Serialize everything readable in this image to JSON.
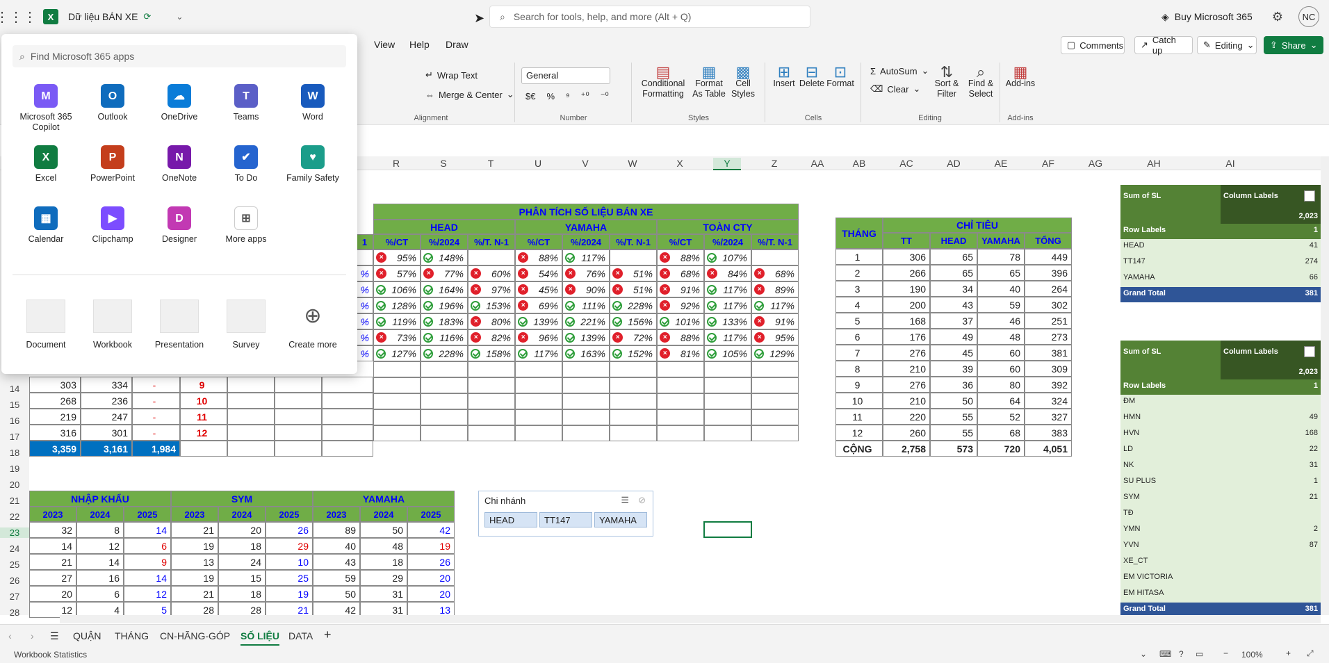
{
  "titlebar": {
    "doc_title": "Dữ liệu BÁN XE",
    "search_placeholder": "Search for tools, help, and more (Alt + Q)",
    "buy_label": "Buy Microsoft 365",
    "avatar_initials": "NC"
  },
  "menu": {
    "tabs": [
      "View",
      "Help",
      "Draw"
    ],
    "comments": "Comments",
    "catchup": "Catch up",
    "editing": "Editing",
    "share": "Share"
  },
  "ribbon": {
    "wrap_text": "Wrap Text",
    "merge_center": "Merge & Center",
    "number_format": "General",
    "conditional_formatting": "Conditional Formatting",
    "format_as_table": "Format As Table",
    "cell_styles": "Cell Styles",
    "insert": "Insert",
    "delete": "Delete",
    "format": "Format",
    "autosum": "AutoSum",
    "clear": "Clear",
    "sort_filter": "Sort & Filter",
    "find_select": "Find & Select",
    "addins": "Add-ins",
    "groups": {
      "alignment": "Alignment",
      "number": "Number",
      "styles": "Styles",
      "cells": "Cells",
      "editing": "Editing",
      "addins": "Add-ins"
    }
  },
  "columns": [
    "R",
    "S",
    "T",
    "U",
    "V",
    "W",
    "X",
    "Y",
    "Z",
    "AA",
    "AB",
    "AC",
    "AD",
    "AE",
    "AF",
    "AG",
    "AH",
    "AI"
  ],
  "rows": [
    "14",
    "15",
    "16",
    "17",
    "18",
    "19",
    "20",
    "21",
    "22",
    "23",
    "24",
    "25",
    "26",
    "27",
    "28"
  ],
  "launcher": {
    "search_placeholder": "Find Microsoft 365 apps",
    "apps": [
      {
        "name": "Microsoft 365 Copilot",
        "color": "#7a5af5",
        "glyph": "M"
      },
      {
        "name": "Outlook",
        "color": "#0f6cbd",
        "glyph": "O"
      },
      {
        "name": "OneDrive",
        "color": "#0a7cd8",
        "glyph": "☁"
      },
      {
        "name": "Teams",
        "color": "#5b5fc7",
        "glyph": "T"
      },
      {
        "name": "Word",
        "color": "#185abd",
        "glyph": "W"
      },
      {
        "name": "Excel",
        "color": "#107c41",
        "glyph": "X"
      },
      {
        "name": "PowerPoint",
        "color": "#c43e1c",
        "glyph": "P"
      },
      {
        "name": "OneNote",
        "color": "#7719aa",
        "glyph": "N"
      },
      {
        "name": "To Do",
        "color": "#2564cf",
        "glyph": "✔"
      },
      {
        "name": "Family Safety",
        "color": "#1b9d8a",
        "glyph": "♥"
      },
      {
        "name": "Calendar",
        "color": "#0f6cbd",
        "glyph": "▦"
      },
      {
        "name": "Clipchamp",
        "color": "#7c4dff",
        "glyph": "▶"
      },
      {
        "name": "Designer",
        "color": "#c239b3",
        "glyph": "D"
      },
      {
        "name": "More apps",
        "color": "#ffffff",
        "glyph": "⊞"
      }
    ],
    "templates": [
      "Document",
      "Workbook",
      "Presentation",
      "Survey",
      "Create more"
    ]
  },
  "analysis": {
    "title": "PHÂN TÍCH SỐ LIỆU BÁN XE",
    "groups": [
      "HEAD",
      "YAMAHA",
      "TOÀN CTY"
    ],
    "subheaders": [
      "%/CT",
      "%/2024",
      "%/T. N-1"
    ],
    "left_edge_col": "1",
    "rows": [
      {
        "lead": "",
        "v": [
          [
            "bad",
            "95%"
          ],
          [
            "ok",
            "148%"
          ],
          [
            "",
            ""
          ],
          [
            "bad",
            "88%"
          ],
          [
            "ok",
            "117%"
          ],
          [
            "",
            ""
          ],
          [
            "bad",
            "88%"
          ],
          [
            "ok",
            "107%"
          ],
          [
            "",
            ""
          ]
        ]
      },
      {
        "lead": "%",
        "v": [
          [
            "bad",
            "57%"
          ],
          [
            "bad",
            "77%"
          ],
          [
            "bad",
            "60%"
          ],
          [
            "bad",
            "54%"
          ],
          [
            "bad",
            "76%"
          ],
          [
            "bad",
            "51%"
          ],
          [
            "bad",
            "68%"
          ],
          [
            "bad",
            "84%"
          ],
          [
            "bad",
            "68%"
          ]
        ]
      },
      {
        "lead": "%",
        "v": [
          [
            "ok",
            "106%"
          ],
          [
            "ok",
            "164%"
          ],
          [
            "bad",
            "97%"
          ],
          [
            "bad",
            "45%"
          ],
          [
            "bad",
            "90%"
          ],
          [
            "bad",
            "51%"
          ],
          [
            "bad",
            "91%"
          ],
          [
            "ok",
            "117%"
          ],
          [
            "bad",
            "89%"
          ]
        ]
      },
      {
        "lead": "%",
        "v": [
          [
            "ok",
            "128%"
          ],
          [
            "ok",
            "196%"
          ],
          [
            "ok",
            "153%"
          ],
          [
            "bad",
            "69%"
          ],
          [
            "ok",
            "111%"
          ],
          [
            "ok",
            "228%"
          ],
          [
            "bad",
            "92%"
          ],
          [
            "ok",
            "117%"
          ],
          [
            "ok",
            "117%"
          ]
        ]
      },
      {
        "lead": "%",
        "v": [
          [
            "ok",
            "119%"
          ],
          [
            "ok",
            "183%"
          ],
          [
            "bad",
            "80%"
          ],
          [
            "ok",
            "139%"
          ],
          [
            "ok",
            "221%"
          ],
          [
            "ok",
            "156%"
          ],
          [
            "ok",
            "101%"
          ],
          [
            "ok",
            "133%"
          ],
          [
            "bad",
            "91%"
          ]
        ]
      },
      {
        "lead": "%",
        "v": [
          [
            "bad",
            "73%"
          ],
          [
            "ok",
            "116%"
          ],
          [
            "bad",
            "82%"
          ],
          [
            "bad",
            "96%"
          ],
          [
            "ok",
            "139%"
          ],
          [
            "bad",
            "72%"
          ],
          [
            "bad",
            "88%"
          ],
          [
            "ok",
            "117%"
          ],
          [
            "bad",
            "95%"
          ]
        ]
      },
      {
        "lead": "%",
        "v": [
          [
            "ok",
            "127%"
          ],
          [
            "ok",
            "228%"
          ],
          [
            "ok",
            "158%"
          ],
          [
            "ok",
            "117%"
          ],
          [
            "ok",
            "163%"
          ],
          [
            "ok",
            "152%"
          ],
          [
            "bad",
            "81%"
          ],
          [
            "ok",
            "105%"
          ],
          [
            "ok",
            "129%"
          ]
        ]
      }
    ]
  },
  "left_block": {
    "rows": [
      {
        "a": "303",
        "b": "334",
        "c": "-",
        "m": "9"
      },
      {
        "a": "268",
        "b": "236",
        "c": "-",
        "m": "10"
      },
      {
        "a": "219",
        "b": "247",
        "c": "-",
        "m": "11"
      },
      {
        "a": "316",
        "b": "301",
        "c": "-",
        "m": "12"
      }
    ],
    "total": {
      "a": "3,359",
      "b": "3,161",
      "c": "1,984"
    }
  },
  "targets": {
    "month_header": "THÁNG",
    "title": "CHỈ TIÊU",
    "cols": [
      "TT",
      "HEAD",
      "YAMAHA",
      "TỔNG"
    ],
    "rows": [
      [
        "1",
        "306",
        "65",
        "78",
        "449"
      ],
      [
        "2",
        "266",
        "65",
        "65",
        "396"
      ],
      [
        "3",
        "190",
        "34",
        "40",
        "264"
      ],
      [
        "4",
        "200",
        "43",
        "59",
        "302"
      ],
      [
        "5",
        "168",
        "37",
        "46",
        "251"
      ],
      [
        "6",
        "176",
        "49",
        "48",
        "273"
      ],
      [
        "7",
        "276",
        "45",
        "60",
        "381"
      ],
      [
        "8",
        "210",
        "39",
        "60",
        "309"
      ],
      [
        "9",
        "276",
        "36",
        "80",
        "392"
      ],
      [
        "10",
        "210",
        "50",
        "64",
        "324"
      ],
      [
        "11",
        "220",
        "55",
        "52",
        "327"
      ],
      [
        "12",
        "260",
        "55",
        "68",
        "383"
      ]
    ],
    "total": [
      "CỘNG",
      "2,758",
      "573",
      "720",
      "4,051"
    ]
  },
  "imports": {
    "groups": [
      "NHẬP KHẨU",
      "SYM",
      "YAMAHA"
    ],
    "years": [
      "2023",
      "2024",
      "2025"
    ],
    "rows": [
      [
        "32",
        "8",
        "14",
        "21",
        "20",
        "26",
        "89",
        "50",
        "42"
      ],
      [
        "14",
        "12",
        "6",
        "19",
        "18",
        "29",
        "40",
        "48",
        "19"
      ],
      [
        "21",
        "14",
        "9",
        "13",
        "24",
        "10",
        "43",
        "18",
        "26"
      ],
      [
        "27",
        "16",
        "14",
        "19",
        "15",
        "25",
        "59",
        "29",
        "20"
      ],
      [
        "20",
        "6",
        "12",
        "21",
        "18",
        "19",
        "50",
        "31",
        "20"
      ],
      [
        "12",
        "4",
        "5",
        "28",
        "28",
        "21",
        "42",
        "31",
        "13"
      ]
    ],
    "red_cells": [
      "1-2",
      "1-5",
      "1-8",
      "2-2"
    ]
  },
  "slicer": {
    "title": "Chi nhánh",
    "items": [
      "HEAD",
      "TT147",
      "YAMAHA"
    ]
  },
  "pivot1": {
    "sum_label": "Sum of SL",
    "col_labels": "Column Labels",
    "year": "2,023",
    "row_labels": "Row Labels",
    "col_value": "1",
    "rows": [
      [
        "HEAD",
        "41"
      ],
      [
        "TT147",
        "274"
      ],
      [
        "YAMAHA",
        "66"
      ]
    ],
    "total": [
      "Grand Total",
      "381"
    ]
  },
  "pivot2": {
    "sum_label": "Sum of SL",
    "col_labels": "Column Labels",
    "year": "2,023",
    "row_labels": "Row Labels",
    "col_value": "1",
    "rows": [
      [
        "ĐM",
        ""
      ],
      [
        "HMN",
        "49"
      ],
      [
        "HVN",
        "168"
      ],
      [
        "LD",
        "22"
      ],
      [
        "NK",
        "31"
      ],
      [
        "SU PLUS",
        "1"
      ],
      [
        "SYM",
        "21"
      ],
      [
        "TĐ",
        ""
      ],
      [
        "YMN",
        "2"
      ],
      [
        "YVN",
        "87"
      ],
      [
        "XE_CT",
        ""
      ],
      [
        "EM VICTORIA",
        ""
      ],
      [
        "EM HITASA",
        ""
      ]
    ],
    "total": [
      "Grand Total",
      "381"
    ]
  },
  "sheets": [
    "QUẬN",
    "THÁNG",
    "CN-HÃNG-GÓP",
    "SỐ LIỆU",
    "DATA"
  ],
  "active_sheet": "SỐ LIỆU",
  "status": {
    "left": "Workbook Statistics",
    "zoom": "100%"
  }
}
